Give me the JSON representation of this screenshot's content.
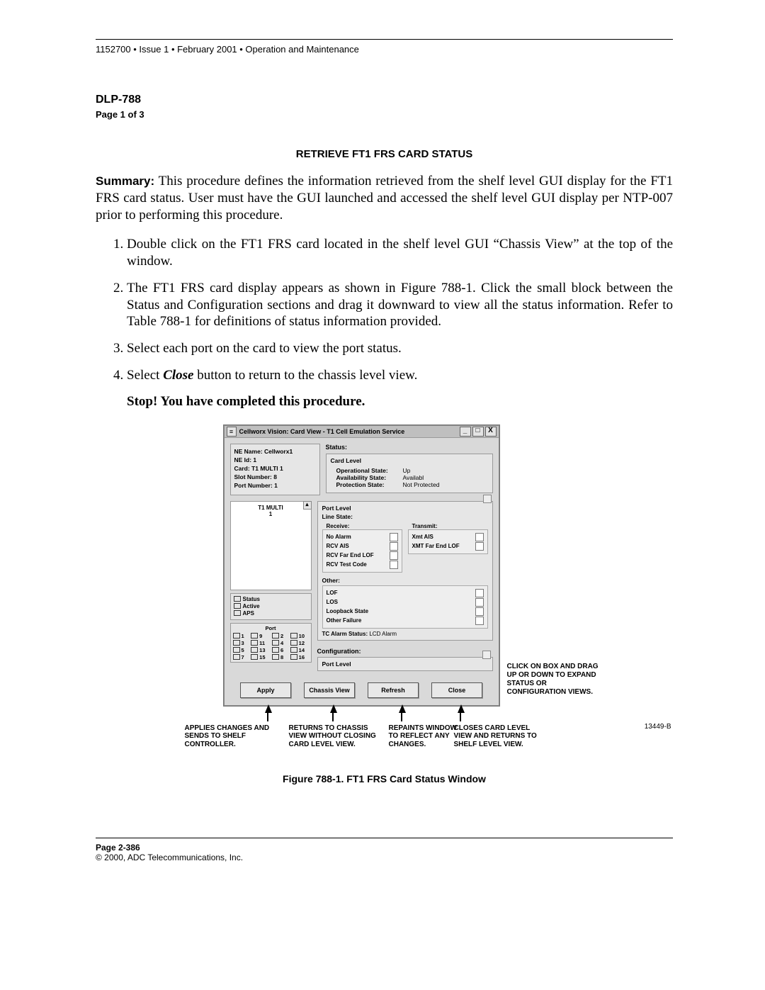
{
  "header_line": "1152700 • Issue 1 • February 2001 • Operation and Maintenance",
  "dlp": "DLP-788",
  "pageof": "Page 1 of 3",
  "title": "RETRIEVE FT1 FRS CARD STATUS",
  "summary_label": "Summary:",
  "summary_text": " This procedure defines the information retrieved from the shelf level GUI display for the FT1 FRS card status. User must have the GUI launched and accessed the shelf level GUI display per NTP-007 prior to performing this procedure.",
  "steps": [
    "Double click on the FT1 FRS card located in the shelf level GUI “Chassis View” at the top of the window.",
    "The FT1 FRS card display appears as shown in Figure 788-1. Click the small block between the Status and Configuration sections and drag it downward to view all the status information. Refer to Table 788-1 for definitions of status information provided.",
    "Select each port on the card to view the port status.",
    "Select Close button to return to the chassis level view."
  ],
  "step4_pre": "Select ",
  "step4_em": "Close",
  "step4_post": " button to return to the chassis level view.",
  "stop": "Stop! You have completed this procedure.",
  "win_title": "Cellworx Vision:  Card View - T1 Cell Emulation Service",
  "info": {
    "ne_name": "NE Name: Cellworx1",
    "ne_id": "NE Id:  1",
    "card": "Card: T1 MULTI 1",
    "slot": "Slot Number:  8",
    "port": "Port Number:  1"
  },
  "status_label": "Status:",
  "card_level_label": "Card Level",
  "op_state_k": "Operational State:",
  "op_state_v": "Up",
  "avail_k": "Availability State:",
  "avail_v": "Availabl",
  "prot_k": "Protection State:",
  "prot_v": "Not Protected",
  "multi_label": "T1 MULTI\n1",
  "legend": {
    "status": "Status",
    "active": "Active",
    "aps": "APS"
  },
  "port_label": "Port",
  "ports_left": [
    "1",
    "2",
    "3",
    "4",
    "5",
    "6",
    "7",
    "8"
  ],
  "ports_right": [
    "9",
    "10",
    "11",
    "12",
    "13",
    "14",
    "15",
    "16"
  ],
  "port_level_label": "Port Level",
  "line_state": "Line State:",
  "receive": "Receive:",
  "transmit": "Transmit:",
  "rcv_rows": [
    "No Alarm",
    "RCV AIS",
    "RCV Far End LOF",
    "RCV Test Code"
  ],
  "xmt_rows": [
    "Xmt AIS",
    "XMT Far End LOF"
  ],
  "other_label": "Other:",
  "other_rows": [
    "LOF",
    "LOS",
    "Loopback State",
    "Other Failure"
  ],
  "tc_alarm_k": "TC Alarm Status:",
  "tc_alarm_v": "LCD Alarm",
  "config_label": "Configuration:",
  "config_port_level": "Port Level",
  "buttons": {
    "apply": "Apply",
    "chassis": "Chassis View",
    "refresh": "Refresh",
    "close": "Close"
  },
  "callouts": {
    "apply": "APPLIES CHANGES AND SENDS TO SHELF CONTROLLER.",
    "chassis": "RETURNS TO CHASSIS VIEW WITHOUT CLOSING CARD LEVEL VIEW.",
    "refresh": "REPAINTS WINDOW TO REFLECT ANY CHANGES.",
    "close": "CLOSES CARD LEVEL VIEW AND RETURNS TO SHELF LEVEL VIEW.",
    "side": "CLICK ON BOX AND DRAG UP OR DOWN TO EXPAND STATUS OR CONFIGURATION VIEWS."
  },
  "drawing_id": "13449-B",
  "figure_caption": "Figure 788-1. FT1 FRS Card Status Window",
  "footer_page": "Page 2-386",
  "footer_copy": "© 2000, ADC Telecommunications, Inc."
}
